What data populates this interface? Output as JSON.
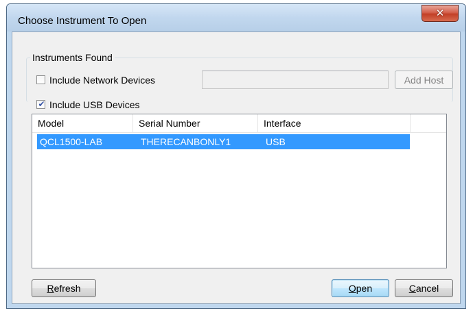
{
  "window": {
    "title": "Choose Instrument To Open",
    "close_glyph": "✕",
    "close_icon": "close-icon"
  },
  "group": {
    "legend": "Instruments Found"
  },
  "network": {
    "label": "Include Network Devices",
    "checked": false,
    "host_value": "",
    "add_host_label": "Add Host",
    "add_host_enabled": false
  },
  "usb": {
    "label": "Include USB Devices",
    "checked": true,
    "check_glyph": "✔"
  },
  "table": {
    "columns": [
      "Model",
      "Serial Number",
      "Interface"
    ],
    "rows": [
      {
        "model": "QCL1500-LAB",
        "serial": "THERECANBONLY1",
        "interface": "USB",
        "selected": true
      }
    ]
  },
  "buttons": {
    "refresh": {
      "accel": "R",
      "rest": "efresh"
    },
    "open": {
      "accel": "O",
      "rest": "pen",
      "default": true
    },
    "cancel": {
      "accel": "C",
      "rest": "ancel"
    }
  },
  "colors": {
    "selection": "#3399ff",
    "close_button": "#c23f27",
    "frame": "#bfd7ee"
  }
}
